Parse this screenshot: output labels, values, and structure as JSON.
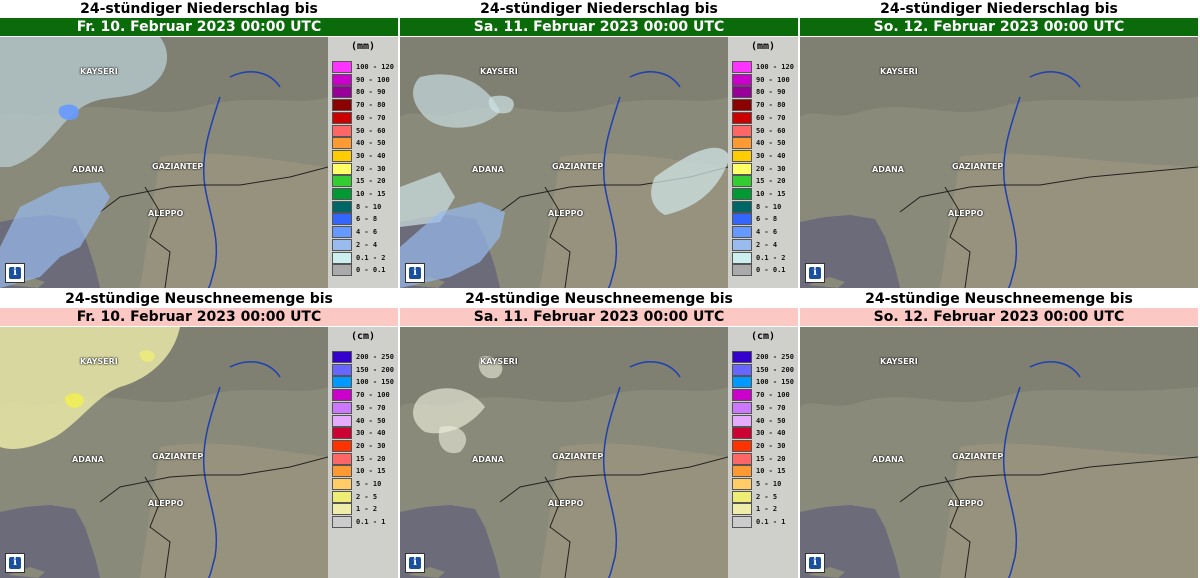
{
  "precip_title": "24-stündiger Niederschlag bis",
  "snow_title": "24-stündige Neuschneemenge bis",
  "dates": [
    "Fr. 10. Februar 2023 00:00 UTC",
    "Sa. 11. Februar 2023 00:00 UTC",
    "So. 12. Februar 2023 00:00 UTC"
  ],
  "cities": {
    "kayseri": "KAYSERI",
    "adana": "ADANA",
    "gaziantep": "GAZIANTEP",
    "aleppo": "ALEPPO"
  },
  "info_icon": "info-icon",
  "precip_legend": {
    "unit": "(mm)",
    "rows": [
      {
        "label": "100 - 120",
        "color": "#ff33ff"
      },
      {
        "label": "90 - 100",
        "color": "#cc00cc"
      },
      {
        "label": "80 - 90",
        "color": "#990099"
      },
      {
        "label": "70 - 80",
        "color": "#8b0000"
      },
      {
        "label": "60 - 70",
        "color": "#cc0000"
      },
      {
        "label": "50 - 60",
        "color": "#ff6666"
      },
      {
        "label": "40 - 50",
        "color": "#ff9933"
      },
      {
        "label": "30 - 40",
        "color": "#ffcc00"
      },
      {
        "label": "20 - 30",
        "color": "#ffff66"
      },
      {
        "label": "15 - 20",
        "color": "#33cc33"
      },
      {
        "label": "10 - 15",
        "color": "#009933"
      },
      {
        "label": "8 - 10",
        "color": "#006666"
      },
      {
        "label": "6 - 8",
        "color": "#3366ff"
      },
      {
        "label": "4 - 6",
        "color": "#6699ff"
      },
      {
        "label": "2 - 4",
        "color": "#99bbee"
      },
      {
        "label": "0.1 - 2",
        "color": "#cceeee"
      },
      {
        "label": "0 - 0.1",
        "color": "#aaaaaa"
      }
    ]
  },
  "snow_legend": {
    "unit": "(cm)",
    "rows": [
      {
        "label": "200 - 250",
        "color": "#3300cc"
      },
      {
        "label": "150 - 200",
        "color": "#6666ff"
      },
      {
        "label": "100 - 150",
        "color": "#0099ff"
      },
      {
        "label": "70 - 100",
        "color": "#cc00cc"
      },
      {
        "label": "50 - 70",
        "color": "#cc77ff"
      },
      {
        "label": "40 - 50",
        "color": "#e6aaff"
      },
      {
        "label": "30 - 40",
        "color": "#cc0033"
      },
      {
        "label": "20 - 30",
        "color": "#ff3300"
      },
      {
        "label": "15 - 20",
        "color": "#ff6666"
      },
      {
        "label": "10 - 15",
        "color": "#ff9933"
      },
      {
        "label": "5 - 10",
        "color": "#ffcc66"
      },
      {
        "label": "2 - 5",
        "color": "#eeee77"
      },
      {
        "label": "1 - 2",
        "color": "#eeeeaa"
      },
      {
        "label": "0.1 - 1",
        "color": "#cccccc"
      }
    ]
  }
}
